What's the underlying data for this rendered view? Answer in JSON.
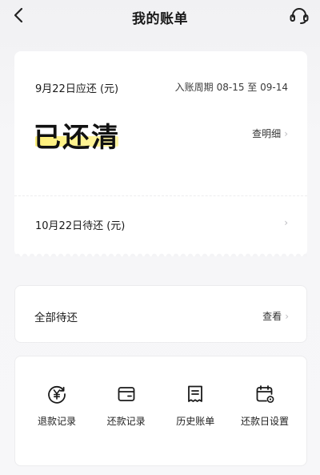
{
  "header": {
    "back_icon": "chevron-left-icon",
    "title": "我的账单",
    "service_icon": "customer-service-headset-icon"
  },
  "current_bill": {
    "due_label": "9月22日应还 (元)",
    "period_label": "入账周期",
    "period_range": "08-15 至 09-14",
    "status": "已还清",
    "detail_link": "查明细",
    "highlight_color": "#fff07a"
  },
  "next_bill": {
    "due_label": "10月22日待还 (元)"
  },
  "pending": {
    "label": "全部待还",
    "view_link": "查看"
  },
  "actions": [
    {
      "label": "退款记录",
      "icon": "refund-yen-icon"
    },
    {
      "label": "还款记录",
      "icon": "wallet-card-icon"
    },
    {
      "label": "历史账单",
      "icon": "receipt-icon"
    },
    {
      "label": "还款日设置",
      "icon": "calendar-settings-icon"
    }
  ],
  "glyphs": {
    "chevron": "›"
  }
}
